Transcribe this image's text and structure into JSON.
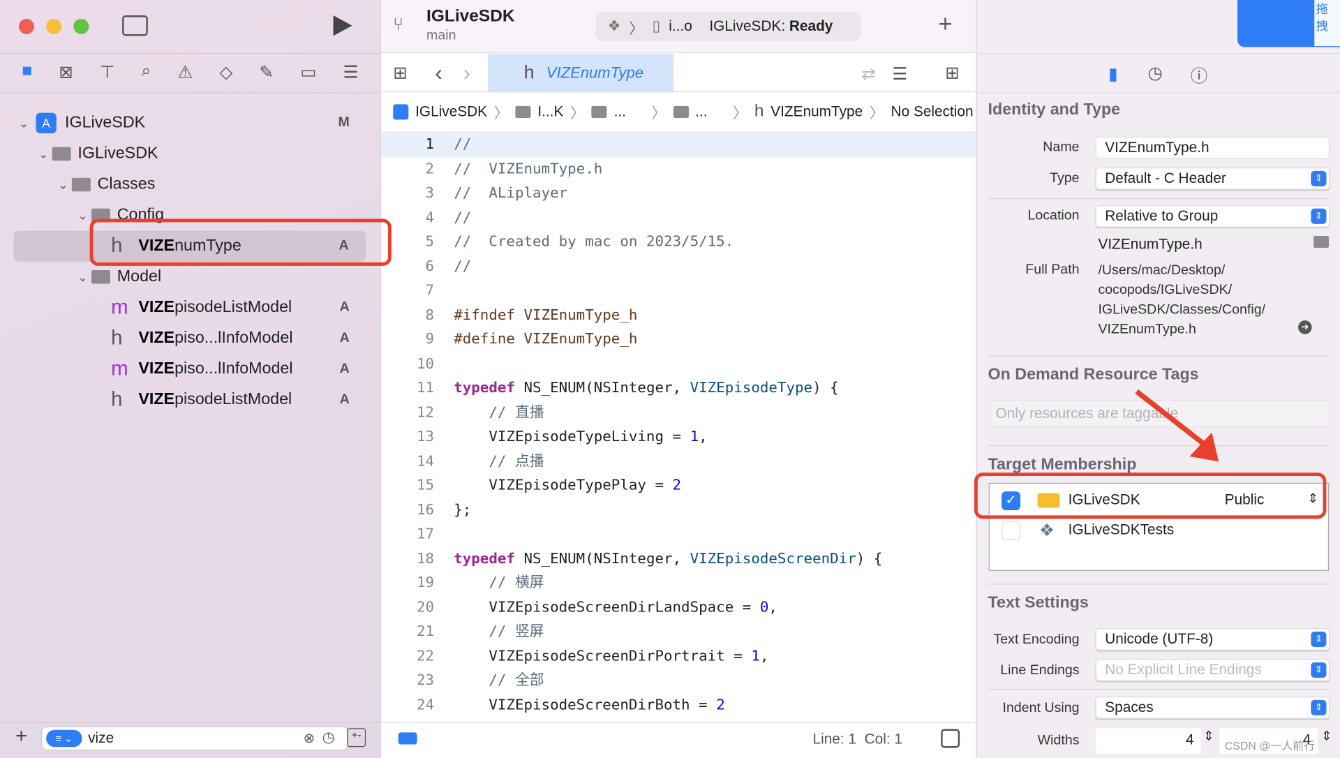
{
  "window": {
    "project": "IGLiveSDK",
    "branch": "main",
    "scheme": "i...o",
    "status_prefix": "IGLiveSDK:",
    "status": "Ready"
  },
  "navigator": {
    "tree": [
      {
        "label": "IGLiveSDK",
        "badge": "M",
        "indent": 0,
        "kind": "project",
        "chev": "v"
      },
      {
        "label": "IGLiveSDK",
        "badge": "",
        "indent": 1,
        "kind": "folder",
        "chev": "v"
      },
      {
        "label": "Classes",
        "badge": "",
        "indent": 2,
        "kind": "folder",
        "chev": "v"
      },
      {
        "label": "Config",
        "badge": "",
        "indent": 3,
        "kind": "folder",
        "chev": "v"
      },
      {
        "bold": "VIZE",
        "label": "numType",
        "badge": "A",
        "indent": 4,
        "kind": "h",
        "selected": true
      },
      {
        "label": "Model",
        "badge": "",
        "indent": 3,
        "kind": "folder",
        "chev": "v"
      },
      {
        "bold": "VIZE",
        "label": "pisodeListModel",
        "badge": "A",
        "indent": 4,
        "kind": "m"
      },
      {
        "bold": "VIZE",
        "label": "piso...lInfoModel",
        "badge": "A",
        "indent": 4,
        "kind": "h"
      },
      {
        "bold": "VIZE",
        "label": "piso...lInfoModel",
        "badge": "A",
        "indent": 4,
        "kind": "m"
      },
      {
        "bold": "VIZE",
        "label": "pisodeListModel",
        "badge": "A",
        "indent": 4,
        "kind": "h"
      }
    ],
    "filter_value": "vize"
  },
  "editor": {
    "tab": "VIZEnumType",
    "breadcrumb": [
      "IGLiveSDK",
      "I...K",
      "...",
      "...",
      "VIZEnumType",
      "No Selection"
    ],
    "status": {
      "line": "Line: 1",
      "col": "Col: 1"
    },
    "lines": [
      [
        [
          "comment",
          "//"
        ]
      ],
      [
        [
          "comment",
          "//  VIZEnumType.h"
        ]
      ],
      [
        [
          "comment",
          "//  ALiplayer"
        ]
      ],
      [
        [
          "comment",
          "//"
        ]
      ],
      [
        [
          "comment",
          "//  Created by mac on 2023/5/15."
        ]
      ],
      [
        [
          "comment",
          "//"
        ]
      ],
      [],
      [
        [
          "pre",
          "#ifndef VIZEnumType_h"
        ]
      ],
      [
        [
          "pre",
          "#define VIZEnumType_h"
        ]
      ],
      [],
      [
        [
          "kw",
          "typedef"
        ],
        [
          "plain",
          " NS_ENUM(NSInteger, "
        ],
        [
          "type",
          "VIZEpisodeType"
        ],
        [
          "plain",
          ") {"
        ]
      ],
      [
        [
          "comment",
          "    // 直播"
        ]
      ],
      [
        [
          "plain",
          "    VIZEpisodeTypeLiving = "
        ],
        [
          "num",
          "1"
        ],
        [
          "plain",
          ","
        ]
      ],
      [
        [
          "comment",
          "    // 点播"
        ]
      ],
      [
        [
          "plain",
          "    VIZEpisodeTypePlay = "
        ],
        [
          "num",
          "2"
        ]
      ],
      [
        [
          "plain",
          "};"
        ]
      ],
      [],
      [
        [
          "kw",
          "typedef"
        ],
        [
          "plain",
          " NS_ENUM(NSInteger, "
        ],
        [
          "type",
          "VIZEpisodeScreenDir"
        ],
        [
          "plain",
          ") {"
        ]
      ],
      [
        [
          "comment",
          "    // 横屏"
        ]
      ],
      [
        [
          "plain",
          "    VIZEpisodeScreenDirLandSpace = "
        ],
        [
          "num",
          "0"
        ],
        [
          "plain",
          ","
        ]
      ],
      [
        [
          "comment",
          "    // 竖屏"
        ]
      ],
      [
        [
          "plain",
          "    VIZEpisodeScreenDirPortrait = "
        ],
        [
          "num",
          "1"
        ],
        [
          "plain",
          ","
        ]
      ],
      [
        [
          "comment",
          "    // 全部"
        ]
      ],
      [
        [
          "plain",
          "    VIZEpisodeScreenDirBoth = "
        ],
        [
          "num",
          "2"
        ]
      ]
    ]
  },
  "inspector": {
    "identity": {
      "title": "Identity and Type",
      "name_label": "Name",
      "name": "VIZEnumType.h",
      "type_label": "Type",
      "type": "Default - C Header",
      "location_label": "Location",
      "location": "Relative to Group",
      "location_file": "VIZEnumType.h",
      "fullpath_label": "Full Path",
      "fullpath": [
        "/Users/mac/Desktop/",
        "cocopods/IGLiveSDK/",
        "IGLiveSDK/Classes/Config/",
        "VIZEnumType.h"
      ]
    },
    "odr": {
      "title": "On Demand Resource Tags",
      "placeholder": "Only resources are taggable"
    },
    "target": {
      "title": "Target Membership",
      "items": [
        {
          "name": "IGLiveSDK",
          "checked": true,
          "visibility": "Public"
        },
        {
          "name": "IGLiveSDKTests",
          "checked": false
        }
      ]
    },
    "text": {
      "title": "Text Settings",
      "encoding_label": "Text Encoding",
      "encoding": "Unicode (UTF-8)",
      "endings_label": "Line Endings",
      "endings": "No Explicit Line Endings",
      "indent_label": "Indent Using",
      "indent": "Spaces",
      "widths_label": "Widths",
      "tab_width": "4",
      "indent_width": "4"
    }
  },
  "overlay": {
    "watermark": "CSDN @一人前行",
    "corner_text": "拖拽"
  },
  "colors": {
    "accent": "#2e7cf6",
    "annotation": "#e8402d",
    "selection": "#d4e5fb"
  }
}
